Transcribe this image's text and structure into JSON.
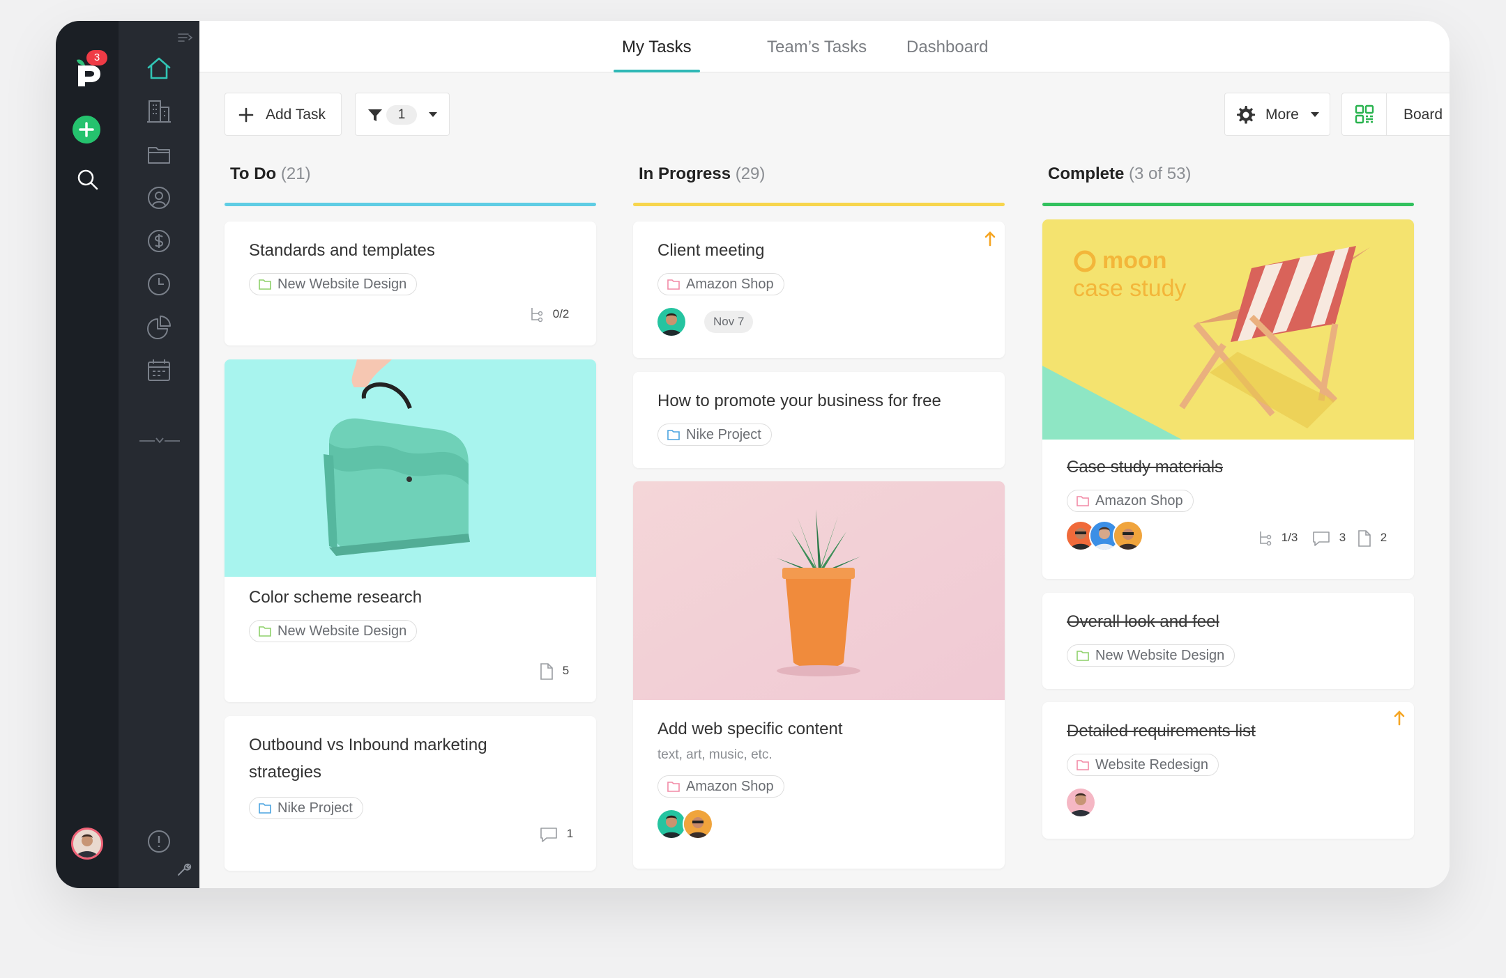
{
  "tabs": {
    "my_tasks": "My Tasks",
    "team_tasks": "Team’s Tasks",
    "dashboard": "Dashboard"
  },
  "notifications": {
    "badge": "3"
  },
  "toolbar": {
    "add_task": "Add Task",
    "filter_count": "1",
    "more": "More",
    "view": "Board"
  },
  "columns": {
    "todo": {
      "title": "To Do",
      "count": "(21)",
      "accent": "#5fcde4"
    },
    "inprogress": {
      "title": "In Progress",
      "count": "(29)",
      "accent": "#f7d54d"
    },
    "complete": {
      "title": "Complete",
      "count": "(3 of 53)",
      "accent": "#32c15e"
    }
  },
  "cards": {
    "standards": {
      "title": "Standards and templates",
      "tag": "New Website Design",
      "subtasks": "0/2"
    },
    "color": {
      "title": "Color scheme research",
      "tag": "New Website Design",
      "files": "5"
    },
    "outbound": {
      "title": "Outbound vs Inbound marketing strategies",
      "tag": "Nike Project",
      "comments": "1"
    },
    "client": {
      "title": "Client meeting",
      "tag": "Amazon Shop",
      "date": "Nov 7"
    },
    "promote": {
      "title": "How to promote your business for free",
      "tag": "Nike Project"
    },
    "webcontent": {
      "title": "Add web specific content",
      "subtitle": "text, art, music, etc.",
      "tag": "Amazon Shop"
    },
    "casestudy": {
      "title": "Case study materials",
      "tag": "Amazon Shop",
      "subtasks": "1/3",
      "comments": "3",
      "files": "2",
      "cover_brand": "moon",
      "cover_line": "case study"
    },
    "overall": {
      "title": "Overall look and feel",
      "tag": "New Website Design"
    },
    "detailed": {
      "title": "Detailed requirements list",
      "tag": "Website Redesign"
    }
  },
  "icons": {
    "tag_green": "folder-icon-green",
    "tag_pink": "folder-icon-pink",
    "tag_blue": "folder-icon-blue",
    "priority": "arrow-up-icon"
  }
}
